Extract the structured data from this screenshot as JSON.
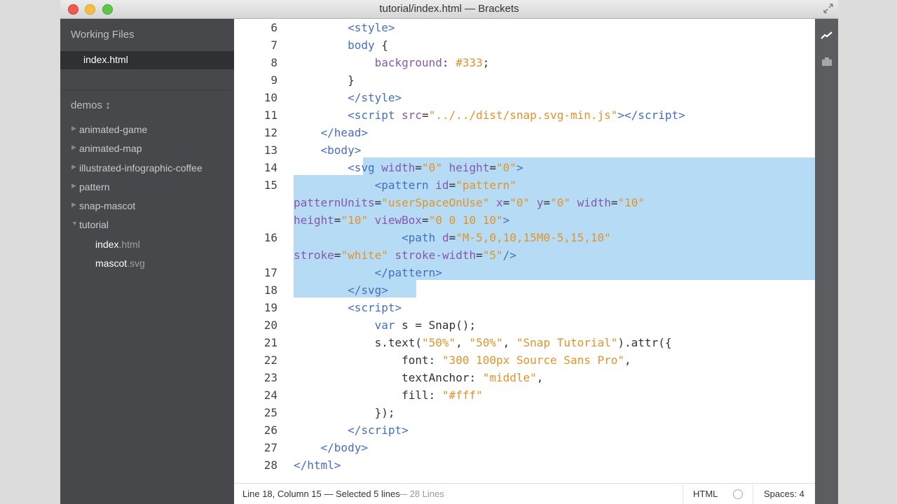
{
  "window": {
    "title": "tutorial/index.html — Brackets"
  },
  "sidebar": {
    "working_files_header": "Working Files",
    "working_files": [
      {
        "name": "index.html"
      }
    ],
    "project_title": "demos ↕",
    "tree": [
      {
        "label": "animated-game",
        "type": "folder",
        "expanded": false
      },
      {
        "label": "animated-map",
        "type": "folder",
        "expanded": false
      },
      {
        "label": "illustrated-infographic-coffee",
        "type": "folder",
        "expanded": false
      },
      {
        "label": "pattern",
        "type": "folder",
        "expanded": false
      },
      {
        "label": "snap-mascot",
        "type": "folder",
        "expanded": false
      },
      {
        "label": "tutorial",
        "type": "folder",
        "expanded": true
      },
      {
        "label": "index",
        "ext": ".html",
        "type": "file"
      },
      {
        "label": "mascot",
        "ext": ".svg",
        "type": "file"
      }
    ]
  },
  "editor": {
    "line_numbers": [
      "6",
      "7",
      "8",
      "9",
      "10",
      "11",
      "12",
      "13",
      "14",
      "15",
      "16",
      "17",
      "18",
      "19",
      "20",
      "21",
      "22",
      "23",
      "24",
      "25",
      "26",
      "27",
      "28"
    ],
    "selected_lines": "14-18"
  },
  "statusbar": {
    "position": "Line 18, Column 15 — Selected 5 lines",
    "line_count": "— 28 Lines",
    "language": "HTML",
    "spaces": "Spaces: 4"
  },
  "colors": {
    "sidebar_bg": "#47484b",
    "selection": "#b6dbf5",
    "tag": "#446fbd",
    "attr": "#8757ad",
    "string": "#e2932a"
  }
}
